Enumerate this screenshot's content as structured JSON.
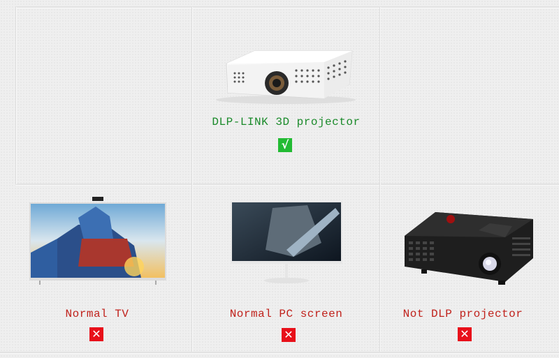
{
  "colors": {
    "supported_text": "#1a8a2a",
    "unsupported_text": "#c0221c",
    "supported_badge": "#22bb33",
    "unsupported_badge": "#e8101a"
  },
  "items": [
    {
      "label": "DLP-LINK 3D projector",
      "status": "supported",
      "icon": "check-icon",
      "badge_glyph": "√",
      "image": "white-dlp-projector"
    },
    {
      "label": "Normal TV",
      "status": "unsupported",
      "icon": "cross-icon",
      "badge_glyph": "✕",
      "image": "flat-screen-tv"
    },
    {
      "label": "Normal PC screen",
      "status": "unsupported",
      "icon": "cross-icon",
      "badge_glyph": "✕",
      "image": "pc-monitor"
    },
    {
      "label": "Not DLP projector",
      "status": "unsupported",
      "icon": "cross-icon",
      "badge_glyph": "✕",
      "image": "black-projector"
    }
  ]
}
